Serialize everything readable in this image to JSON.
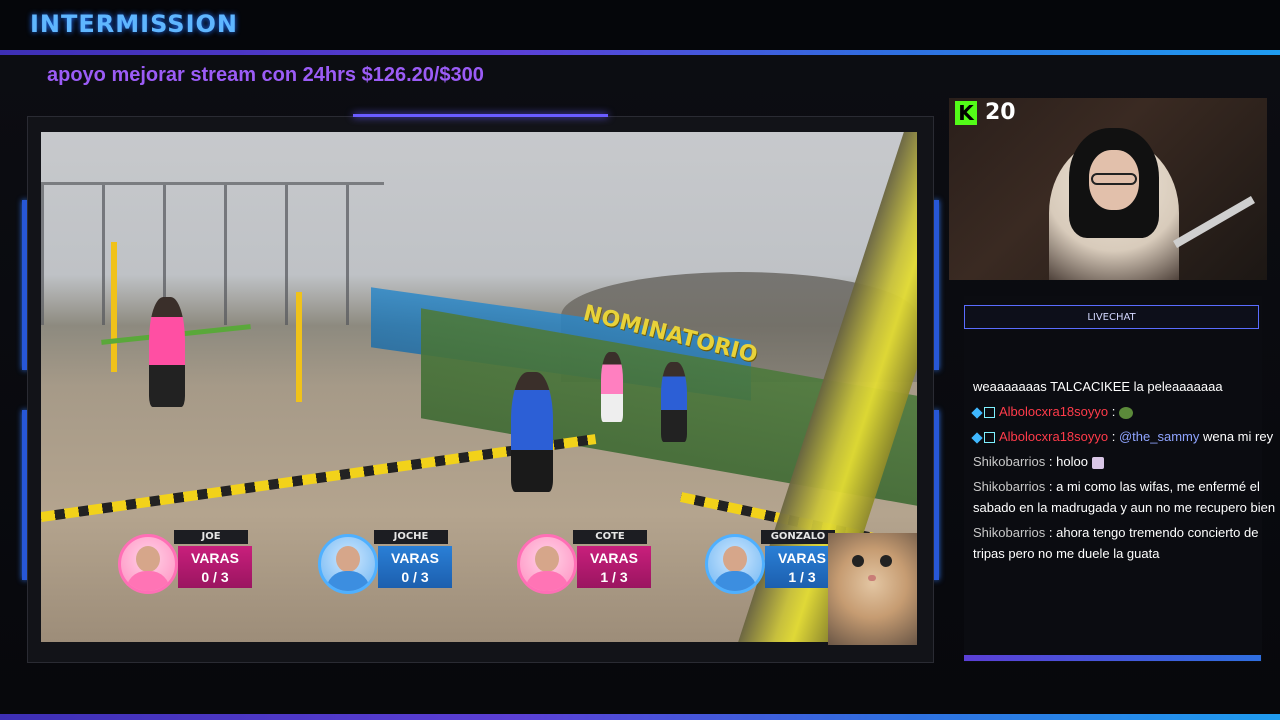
{
  "header": {
    "title": "INTERMISSION"
  },
  "goal": {
    "text": "apoyo mejorar stream con 24hrs $126.20/$300"
  },
  "overlay": {
    "sign_text": "NOMINATORIO"
  },
  "scoreboard": [
    {
      "name": "JOE",
      "label": "VARAS",
      "score": "0 / 3",
      "team": "pink"
    },
    {
      "name": "JOCHE",
      "label": "VARAS",
      "score": "0 / 3",
      "team": "blue"
    },
    {
      "name": "COTE",
      "label": "VARAS",
      "score": "1 / 3",
      "team": "pink"
    },
    {
      "name": "GONZALO",
      "label": "VARAS",
      "score": "1 / 3",
      "team": "blue"
    }
  ],
  "kick": {
    "icon": "K",
    "viewers": "20",
    "color": "#53fc18"
  },
  "chat": {
    "header": "LIVECHAT",
    "messages": [
      {
        "user": "",
        "text": "weaaaaaaas TALCACIKEE la peleaaaaaaa"
      },
      {
        "user": "Albolocxra18soyyo",
        "sep": " :",
        "text": ""
      },
      {
        "user": "Albolocxra18soyyo",
        "sep": " :",
        "mention": "@the_sammy",
        "text": " wena mi rey"
      },
      {
        "user": "Shikobarrios",
        "sep": " :",
        "text": " holoo"
      },
      {
        "user": "Shikobarrios",
        "sep": " :",
        "text": " a mi como las wifas, me enfermé el sabado en la madrugada y aun no me recupero bien"
      },
      {
        "user": "Shikobarrios",
        "sep": " :",
        "text": " ahora tengo tremendo concierto de tripas pero no me duele la guata"
      }
    ]
  },
  "colors": {
    "accent_purple": "#9b5cf6",
    "accent_blue": "#2f6fe0",
    "chat_user_red": "#ff3b4a"
  }
}
